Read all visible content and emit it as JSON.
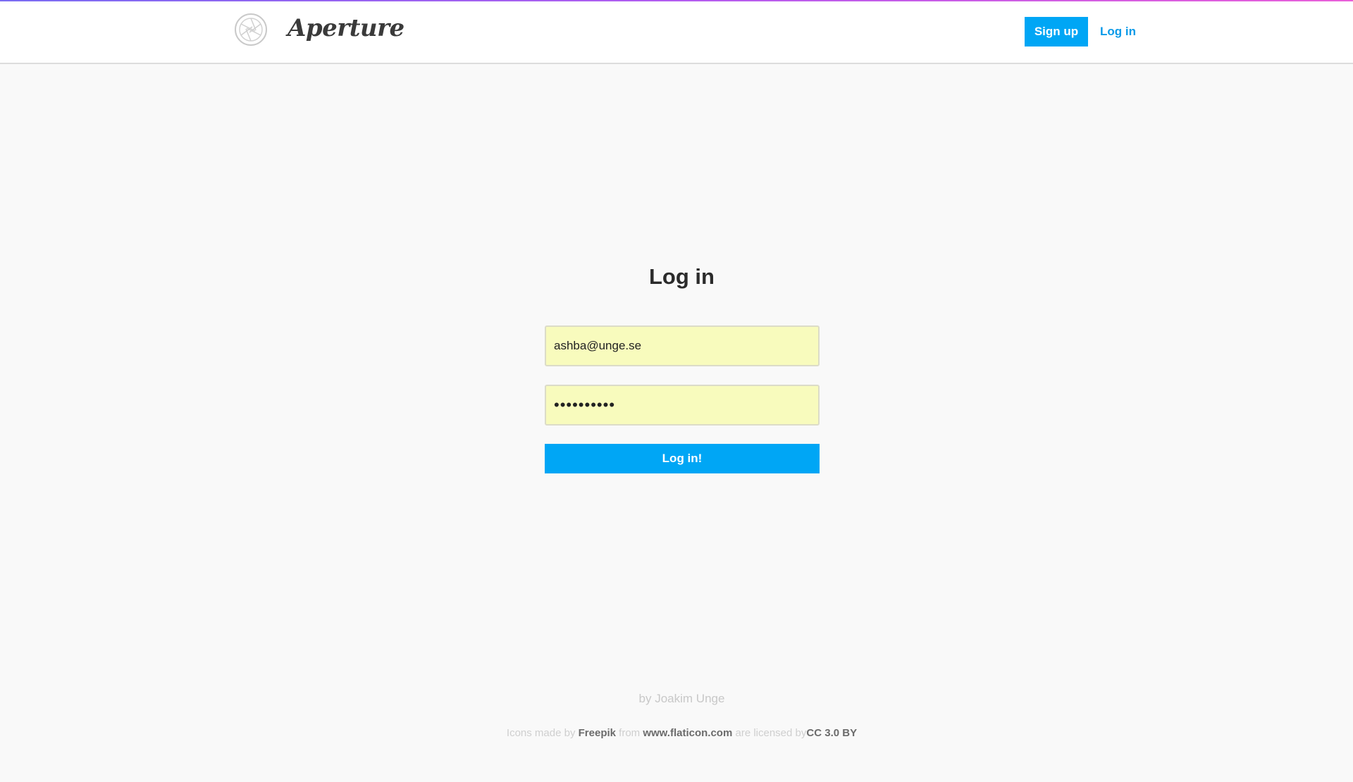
{
  "header": {
    "brand": "Aperture",
    "logo_icon": "camera-aperture-icon",
    "signup_label": "Sign up",
    "login_label": "Log in"
  },
  "login_form": {
    "title": "Log in",
    "email_value": "ashba@unge.se",
    "password_value": "••••••••••",
    "submit_label": "Log in!"
  },
  "footer": {
    "byline": "by Joakim Unge",
    "credits": {
      "prefix": "Icons made by",
      "author": "Freepik",
      "from_text": "from",
      "site": "www.flaticon.com",
      "licensed_text": "are licensed by",
      "license": "CC 3.0 BY"
    }
  },
  "colors": {
    "accent": "#00a6f5",
    "link": "#0b9ae8",
    "autofill_bg": "#f8fbbd",
    "page_bg": "#f9f9f9"
  }
}
